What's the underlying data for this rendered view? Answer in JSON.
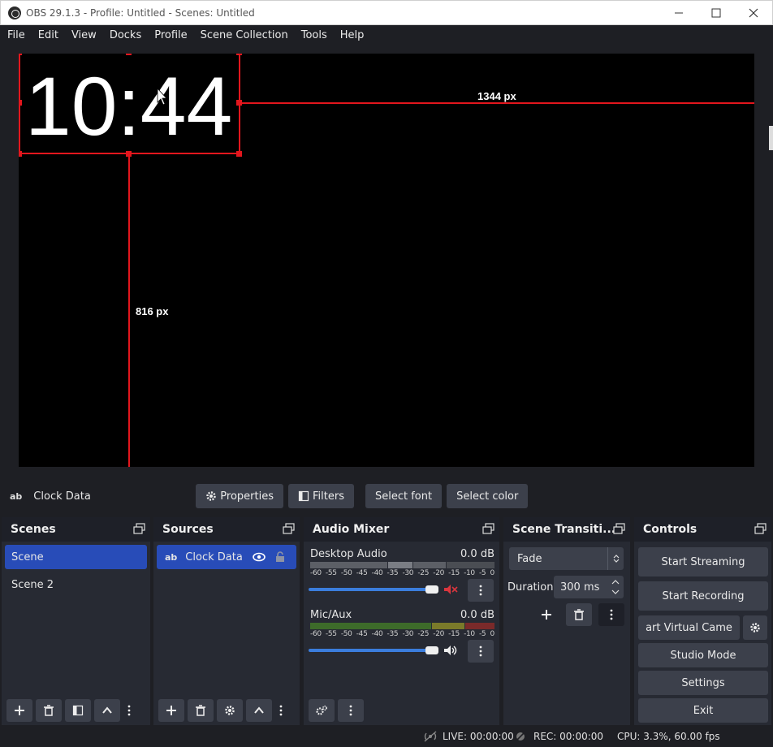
{
  "window": {
    "title": "OBS 29.1.3 - Profile: Untitled - Scenes: Untitled",
    "minimize": "—",
    "maximize": "☐",
    "close": "✕"
  },
  "menu": [
    "File",
    "Edit",
    "View",
    "Docks",
    "Profile",
    "Scene Collection",
    "Tools",
    "Help"
  ],
  "preview": {
    "clock_text": "10:44",
    "width_label": "1344 px",
    "height_label": "816 px",
    "guide_color": "#e3161d"
  },
  "source_toolbar": {
    "type_icon": "ab",
    "source_name": "Clock Data",
    "properties": "Properties",
    "filters": "Filters",
    "select_font": "Select font",
    "select_color": "Select color"
  },
  "scenes": {
    "title": "Scenes",
    "items": [
      {
        "label": "Scene",
        "selected": true
      },
      {
        "label": "Scene 2",
        "selected": false
      }
    ]
  },
  "sources": {
    "title": "Sources",
    "items": [
      {
        "type_icon": "ab",
        "label": "Clock Data",
        "selected": true
      }
    ]
  },
  "audio_mixer": {
    "title": "Audio Mixer",
    "channels": [
      {
        "name": "Desktop Audio",
        "level": "0.0 dB",
        "muted": true,
        "volume": 1.0
      },
      {
        "name": "Mic/Aux",
        "level": "0.0 dB",
        "muted": false,
        "volume": 1.0
      }
    ],
    "ticks": [
      "-60",
      "-55",
      "-50",
      "-45",
      "-40",
      "-35",
      "-30",
      "-25",
      "-20",
      "-15",
      "-10",
      "-5",
      "0"
    ]
  },
  "transitions": {
    "title": "Scene Transiti...",
    "selected": "Fade",
    "duration_label": "Duration",
    "duration_value": "300 ms"
  },
  "controls": {
    "title": "Controls",
    "start_streaming": "Start Streaming",
    "start_recording": "Start Recording",
    "virtual_camera": "art Virtual Came",
    "studio_mode": "Studio Mode",
    "settings": "Settings",
    "exit": "Exit"
  },
  "status": {
    "live": "LIVE: 00:00:00",
    "rec": "REC: 00:00:00",
    "cpu": "CPU: 3.3%, 60.00 fps"
  },
  "colors": {
    "accent": "#284cb8",
    "button": "#3c404b",
    "dock": "#272a33",
    "muted_red": "#d9363e"
  }
}
